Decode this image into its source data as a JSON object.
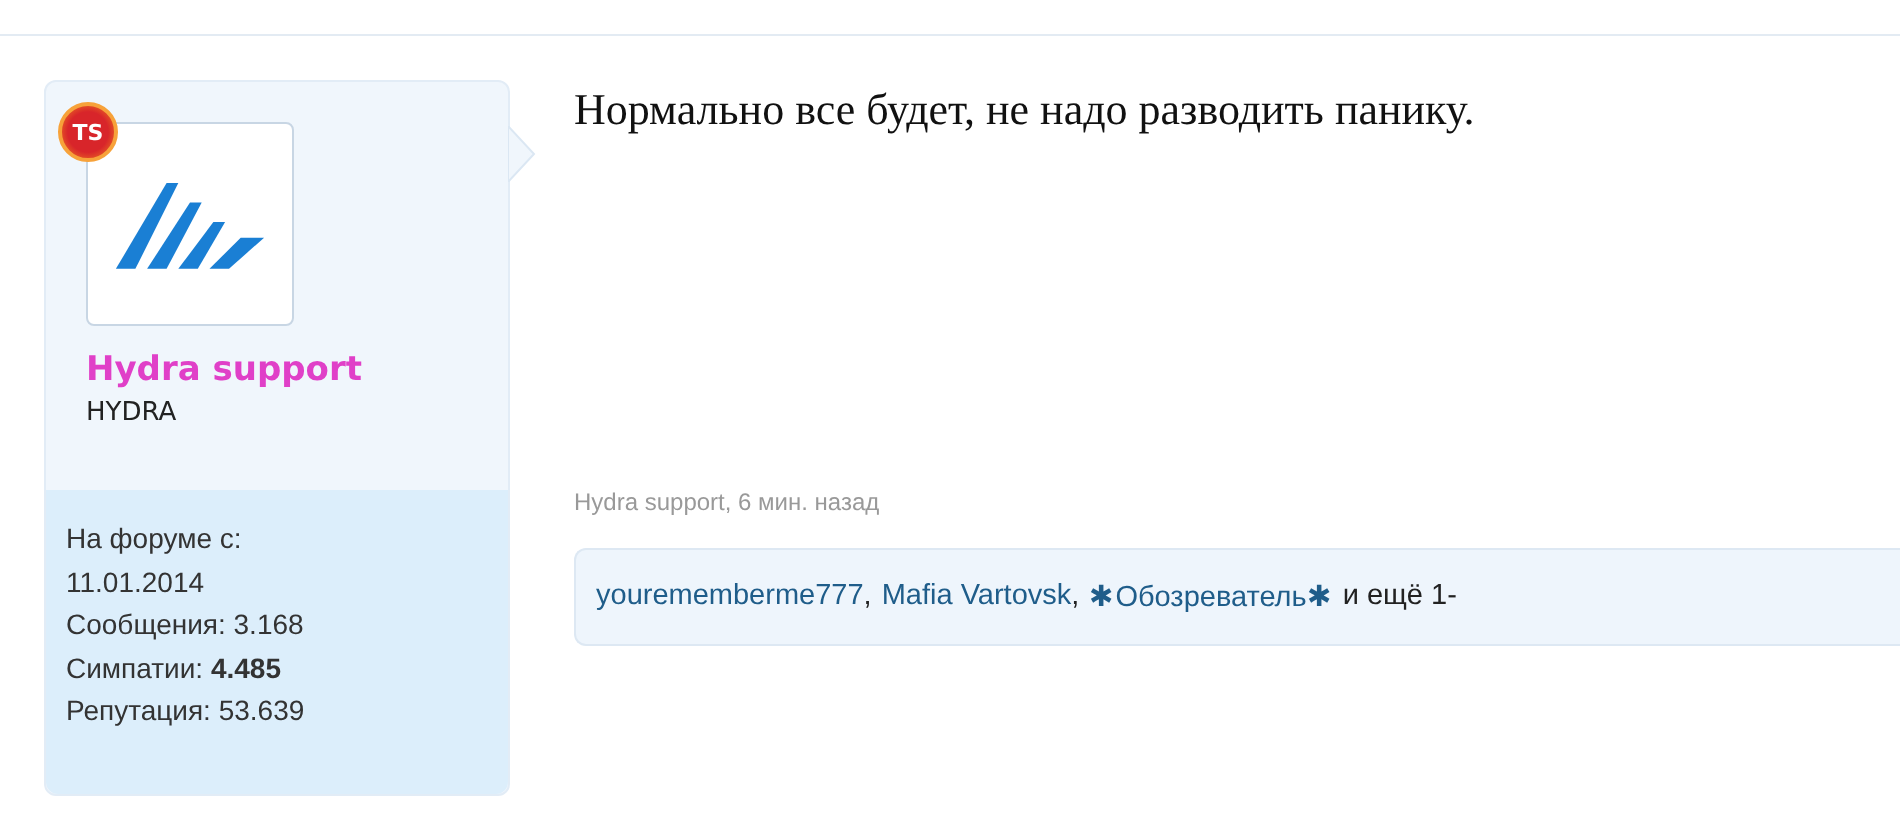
{
  "author": {
    "badge": "TS",
    "name": "Hydra support",
    "title": "HYDRA",
    "stats": [
      {
        "label": "На форуме с:",
        "value": "11.01.2014",
        "bold": false,
        "block": true
      },
      {
        "label": "Сообщения:",
        "value": "3.168",
        "bold": false,
        "block": false
      },
      {
        "label": "Симпатии:",
        "value": "4.485",
        "bold": true,
        "block": false
      },
      {
        "label": "Репутация:",
        "value": "53.639",
        "bold": false,
        "block": false
      }
    ]
  },
  "post": {
    "message": "Нормально все будет, не надо разводить панику.",
    "meta": "Hydra support, 6 мин. назад",
    "likes": [
      {
        "kind": "link",
        "text": "yourememberme777"
      },
      {
        "kind": "plain",
        "text": ","
      },
      {
        "kind": "link",
        "text": "Mafia Vartovsk"
      },
      {
        "kind": "plain",
        "text": ","
      },
      {
        "kind": "link",
        "text": "✱Обозреватель✱"
      },
      {
        "kind": "plain",
        "text": "и ещё 1-"
      }
    ]
  }
}
